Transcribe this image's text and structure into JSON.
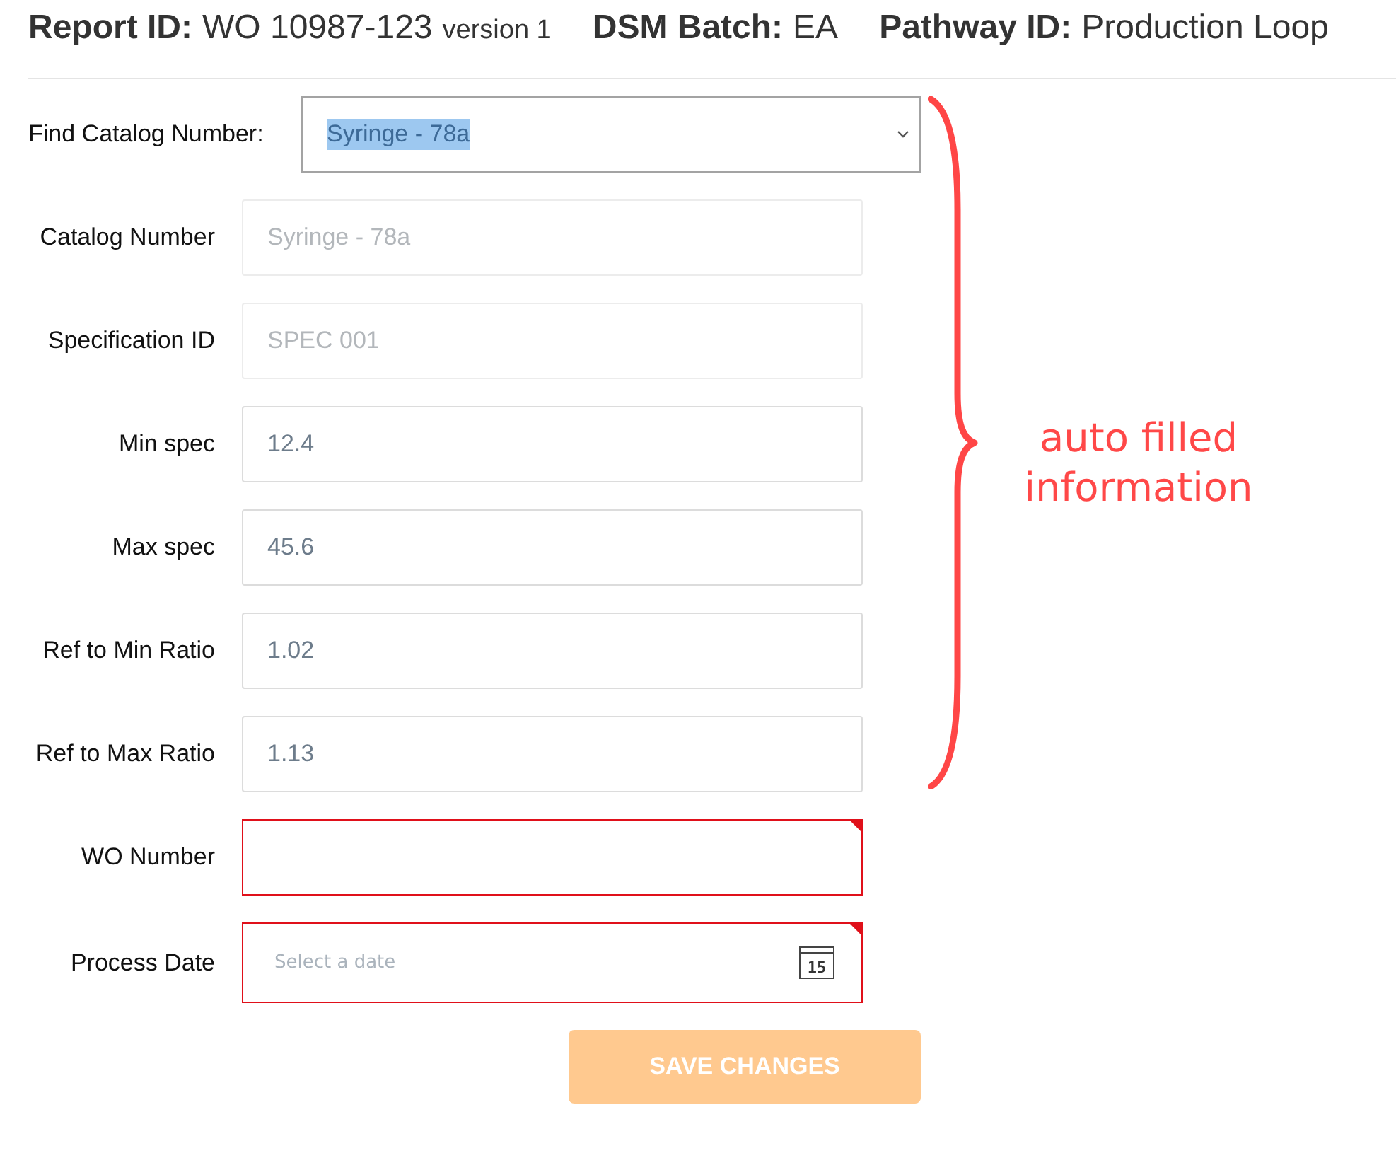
{
  "header": {
    "items": [
      {
        "label": "Report ID:",
        "value": "WO 10987-123",
        "note": "version 1"
      },
      {
        "label": "DSM Batch:",
        "value": "EA"
      },
      {
        "label": "Pathway ID:",
        "value": "Production Loop"
      }
    ]
  },
  "catalog_finder": {
    "label": "Find Catalog Number:",
    "value": "Syringe - 78a",
    "text_selected": true
  },
  "fields": [
    {
      "kind": "text",
      "label": "Catalog Number",
      "value": "Syringe - 78a",
      "disabled": true,
      "required": false
    },
    {
      "kind": "text",
      "label": "Specification ID",
      "value": "SPEC 001",
      "disabled": true,
      "required": false
    },
    {
      "kind": "text",
      "label": "Min spec",
      "value": "12.4",
      "disabled": false,
      "required": false
    },
    {
      "kind": "text",
      "label": "Max spec",
      "value": "45.6",
      "disabled": false,
      "required": false
    },
    {
      "kind": "text",
      "label": "Ref to Min Ratio",
      "value": "1.02",
      "disabled": false,
      "required": false
    },
    {
      "kind": "text",
      "label": "Ref to Max Ratio",
      "value": "1.13",
      "disabled": false,
      "required": false
    },
    {
      "kind": "text",
      "label": "WO Number",
      "disabled": false,
      "required": true
    },
    {
      "kind": "date",
      "label": "Process Date",
      "placeholder": "Select a date",
      "icon_day": "15",
      "disabled": false,
      "required": true
    }
  ],
  "save_button": {
    "label": "SAVE CHANGES",
    "disabled": true
  },
  "annotation": {
    "text": "auto filled information"
  }
}
